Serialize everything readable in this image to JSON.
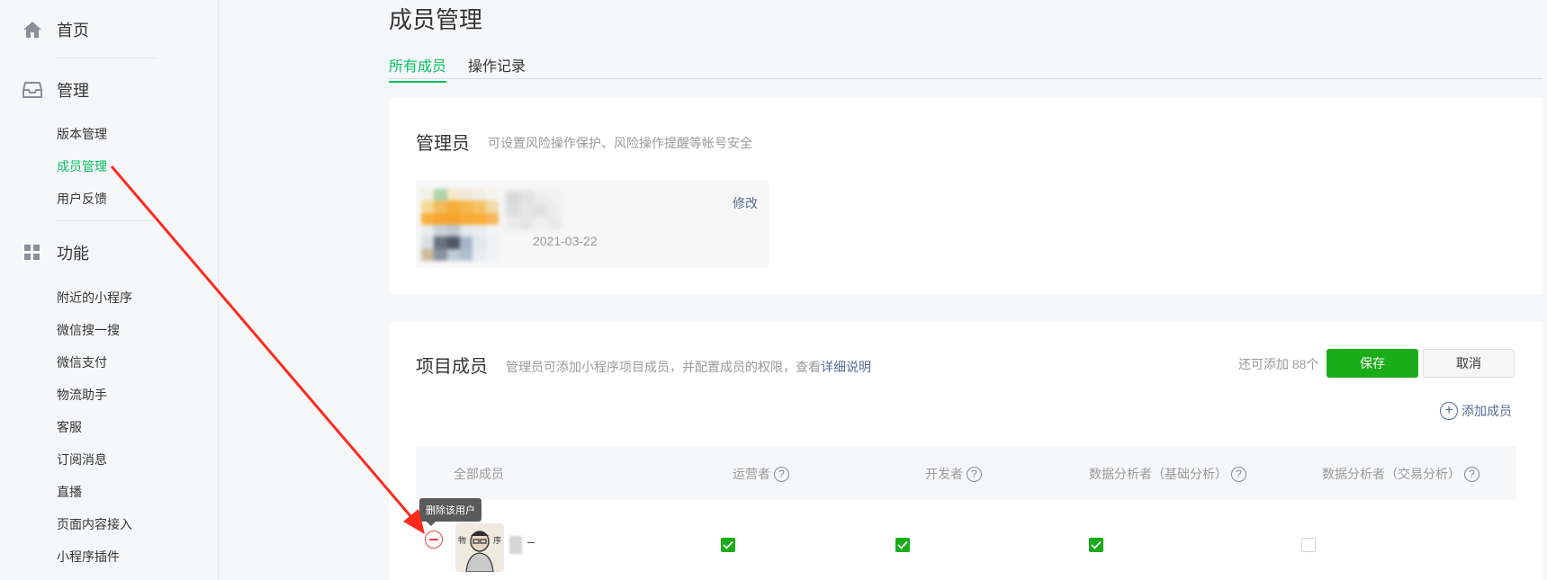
{
  "colors": {
    "accent": "#07c160",
    "button_green": "#1aad19",
    "link": "#576b95",
    "annotation": "#ff2a1d"
  },
  "sidebar": {
    "groups": [
      {
        "icon": "home-icon",
        "label": "首页"
      },
      {
        "icon": "inbox-icon",
        "label": "管理",
        "items": [
          "版本管理",
          "成员管理",
          "用户反馈"
        ],
        "active": "成员管理"
      },
      {
        "icon": "grid-icon",
        "label": "功能",
        "items": [
          "附近的小程序",
          "微信搜一搜",
          "微信支付",
          "物流助手",
          "客服",
          "订阅消息",
          "直播",
          "页面内容接入",
          "小程序插件"
        ]
      }
    ]
  },
  "page": {
    "title": "成员管理",
    "tabs": [
      "所有成员",
      "操作记录"
    ],
    "active_tab": "所有成员"
  },
  "admin": {
    "title": "管理员",
    "desc": "可设置风险操作保护、风险操作提醒等帐号安全",
    "date": "2021-03-22",
    "edit_label": "修改"
  },
  "members": {
    "title": "项目成员",
    "desc": "管理员可添加小程序项目成员，并配置成员的权限，查看",
    "desc_link": "详细说明",
    "remaining": "还可添加 88个",
    "save_label": "保存",
    "cancel_label": "取消",
    "add_label": "添加成员",
    "columns": [
      "全部成员",
      "运营者",
      "开发者",
      "数据分析者（基础分析）",
      "数据分析者（交易分析）"
    ],
    "rows": [
      {
        "name_suffix": "–",
        "permissions": [
          true,
          true,
          true,
          false
        ]
      }
    ],
    "remove_tooltip": "删除该用户"
  }
}
